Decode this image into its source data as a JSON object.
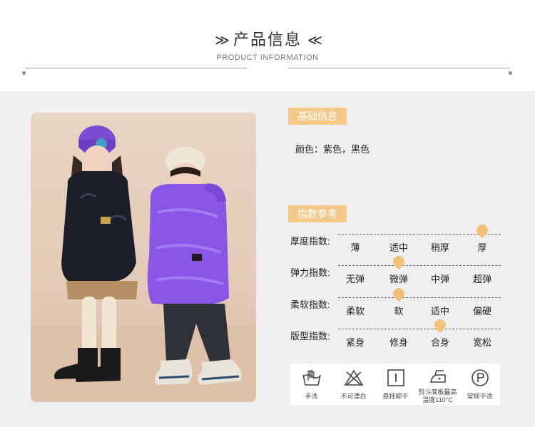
{
  "header": {
    "title": "产品信息",
    "left_arrow": "≫",
    "right_arrow": "≪",
    "subtitle": "PRODUCT INFORMATION"
  },
  "basic_info": {
    "tag": "基础信息",
    "color_line": "颜色：紫色，黑色"
  },
  "index_ref": {
    "tag": "指数参考",
    "rows": [
      {
        "label": "厚度指数:",
        "options": [
          "薄",
          "适中",
          "稍厚",
          "厚"
        ],
        "selected": 3
      },
      {
        "label": "弹力指数:",
        "options": [
          "无弹",
          "微弹",
          "中弹",
          "超弹"
        ],
        "selected": 1
      },
      {
        "label": "柔软指数:",
        "options": [
          "柔软",
          "软",
          "适中",
          "偏硬"
        ],
        "selected": 1
      },
      {
        "label": "版型指数:",
        "options": [
          "紧身",
          "修身",
          "合身",
          "宽松"
        ],
        "selected": 2
      }
    ]
  },
  "care": [
    {
      "icon": "hand-wash-icon",
      "label": "手洗"
    },
    {
      "icon": "no-bleach-icon",
      "label": "不可漂白"
    },
    {
      "icon": "hang-dry-icon",
      "label": "悬挂晾干"
    },
    {
      "icon": "iron-icon",
      "label": "熨斗底板最高\n温度110°C"
    },
    {
      "icon": "dry-clean-icon",
      "label": "常规干洗"
    }
  ],
  "colors": {
    "accent": "#f5c98a",
    "marker": "#f2c27b",
    "panel_bg": "#efefef"
  }
}
